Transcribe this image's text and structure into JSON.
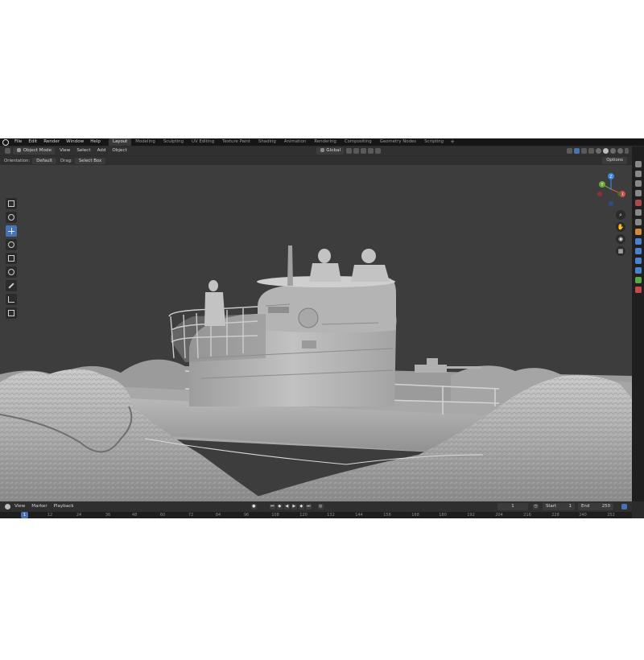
{
  "menubar": {
    "menus": [
      "File",
      "Edit",
      "Render",
      "Window",
      "Help"
    ],
    "workspaces": [
      "Layout",
      "Modeling",
      "Sculpting",
      "UV Editing",
      "Texture Paint",
      "Shading",
      "Animation",
      "Rendering",
      "Compositing",
      "Geometry Nodes",
      "Scripting"
    ],
    "active_workspace": "Layout",
    "add_label": "+"
  },
  "header": {
    "mode": "Object Mode",
    "menus": [
      "View",
      "Select",
      "Add",
      "Object"
    ],
    "transform_orientation": "Global"
  },
  "toolsettings": {
    "orientation_label": "Orientation:",
    "orientation_value": "Default",
    "drag_label": "Drag:",
    "drag_value": "Select Box",
    "options_label": "Options"
  },
  "toolbar": {
    "tools": [
      "select-box-tool",
      "cursor-tool",
      "move-tool",
      "rotate-tool",
      "scale-tool",
      "transform-tool",
      "annotate-tool",
      "measure-tool",
      "add-cube-tool"
    ],
    "active_tool": "move-tool"
  },
  "gizmo": {
    "x": "X",
    "y": "Y",
    "z": "Z"
  },
  "timeline": {
    "menus": [
      "View",
      "Marker",
      "Playback"
    ],
    "current_frame": "1",
    "start_label": "Start",
    "start_value": "1",
    "end_label": "End",
    "end_value": "250",
    "ruler": [
      "1",
      "12",
      "24",
      "36",
      "48",
      "60",
      "72",
      "84",
      "96",
      "108",
      "120",
      "132",
      "144",
      "156",
      "168",
      "180",
      "192",
      "204",
      "216",
      "228",
      "240",
      "252"
    ]
  },
  "colors": {
    "accent": "#4772b3",
    "axis_x": "#e0474c",
    "axis_y": "#6aa83a",
    "axis_z": "#3c86e0"
  }
}
